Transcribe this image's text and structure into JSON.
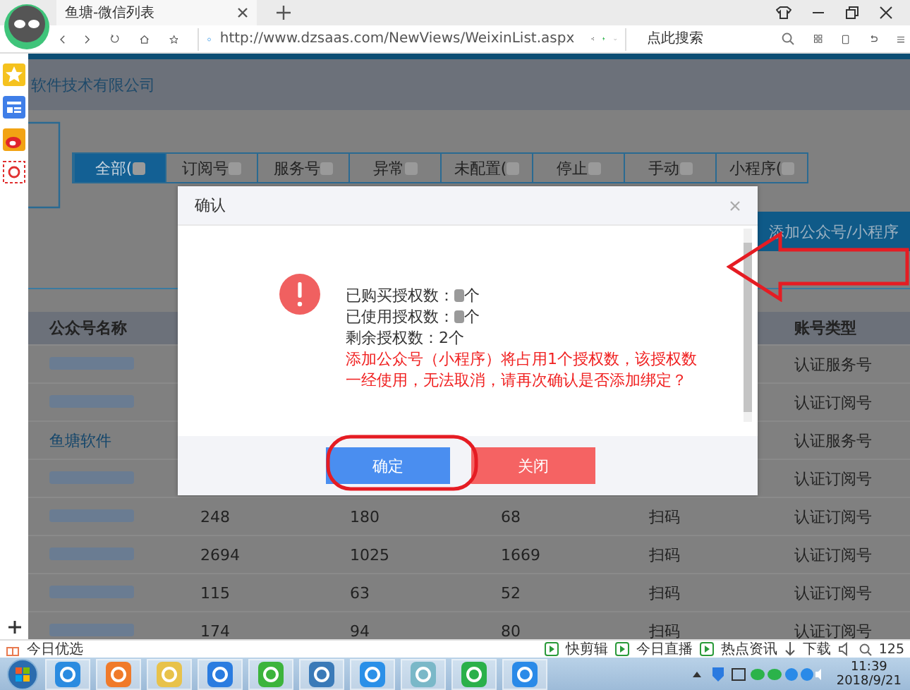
{
  "browser": {
    "tab_title": "鱼塘-微信列表",
    "url": "http://www.dzsaas.com/NewViews/WeixinList.aspx",
    "search_placeholder": "点此搜索"
  },
  "page": {
    "company": "软件技术有限公司",
    "add_button": "添加公众号/小程序",
    "tabs": [
      {
        "label": "全部(",
        "selected": true
      },
      {
        "label": "订阅号",
        "selected": false
      },
      {
        "label": "服务号",
        "selected": false
      },
      {
        "label": "异常",
        "selected": false
      },
      {
        "label": "未配置(",
        "selected": false
      },
      {
        "label": "停止",
        "selected": false
      },
      {
        "label": "手动",
        "selected": false
      },
      {
        "label": "小程序(",
        "selected": false
      }
    ],
    "table": {
      "columns": [
        "公众号名称",
        "账号类型"
      ],
      "rows": [
        {
          "name_blurred": true,
          "type": "认证服务号"
        },
        {
          "name_blurred": true,
          "type": "认证订阅号"
        },
        {
          "name": "鱼塘软件",
          "name_blurred": false,
          "type": "认证服务号"
        },
        {
          "name_blurred": true,
          "type": "认证订阅号"
        },
        {
          "name_blurred": true,
          "cells": [
            "248",
            "180",
            "68",
            "扫码"
          ],
          "type": "认证订阅号"
        },
        {
          "name_blurred": true,
          "cells": [
            "2694",
            "1025",
            "1669",
            "扫码"
          ],
          "type": "认证订阅号"
        },
        {
          "name_blurred": true,
          "cells": [
            "115",
            "63",
            "52",
            "扫码"
          ],
          "type": "认证订阅号"
        },
        {
          "name_blurred": true,
          "cells": [
            "174",
            "94",
            "80",
            "扫码"
          ],
          "type": "认证订阅号"
        }
      ]
    }
  },
  "dialog": {
    "title": "确认",
    "lines": [
      {
        "prefix": "已购买授权数：",
        "value_blurred": true,
        "suffix": "个"
      },
      {
        "prefix": "已使用授权数：",
        "value_blurred": true,
        "suffix": "个"
      },
      {
        "prefix": "剩余授权数：2个",
        "value_blurred": false
      }
    ],
    "warning": "添加公众号（小程序）将占用1个授权数，该授权数一经使用，无法取消，请再次确认是否添加绑定？",
    "buttons": [
      {
        "label": "确定",
        "kind": "primary"
      },
      {
        "label": "关闭",
        "kind": "danger"
      }
    ]
  },
  "status_bar": {
    "left": "今日优选",
    "items": [
      "快剪辑",
      "今日直播",
      "热点资讯"
    ],
    "download": "下载",
    "zoom": "125"
  },
  "taskbar": {
    "time": "11:39",
    "date": "2018/9/21"
  }
}
